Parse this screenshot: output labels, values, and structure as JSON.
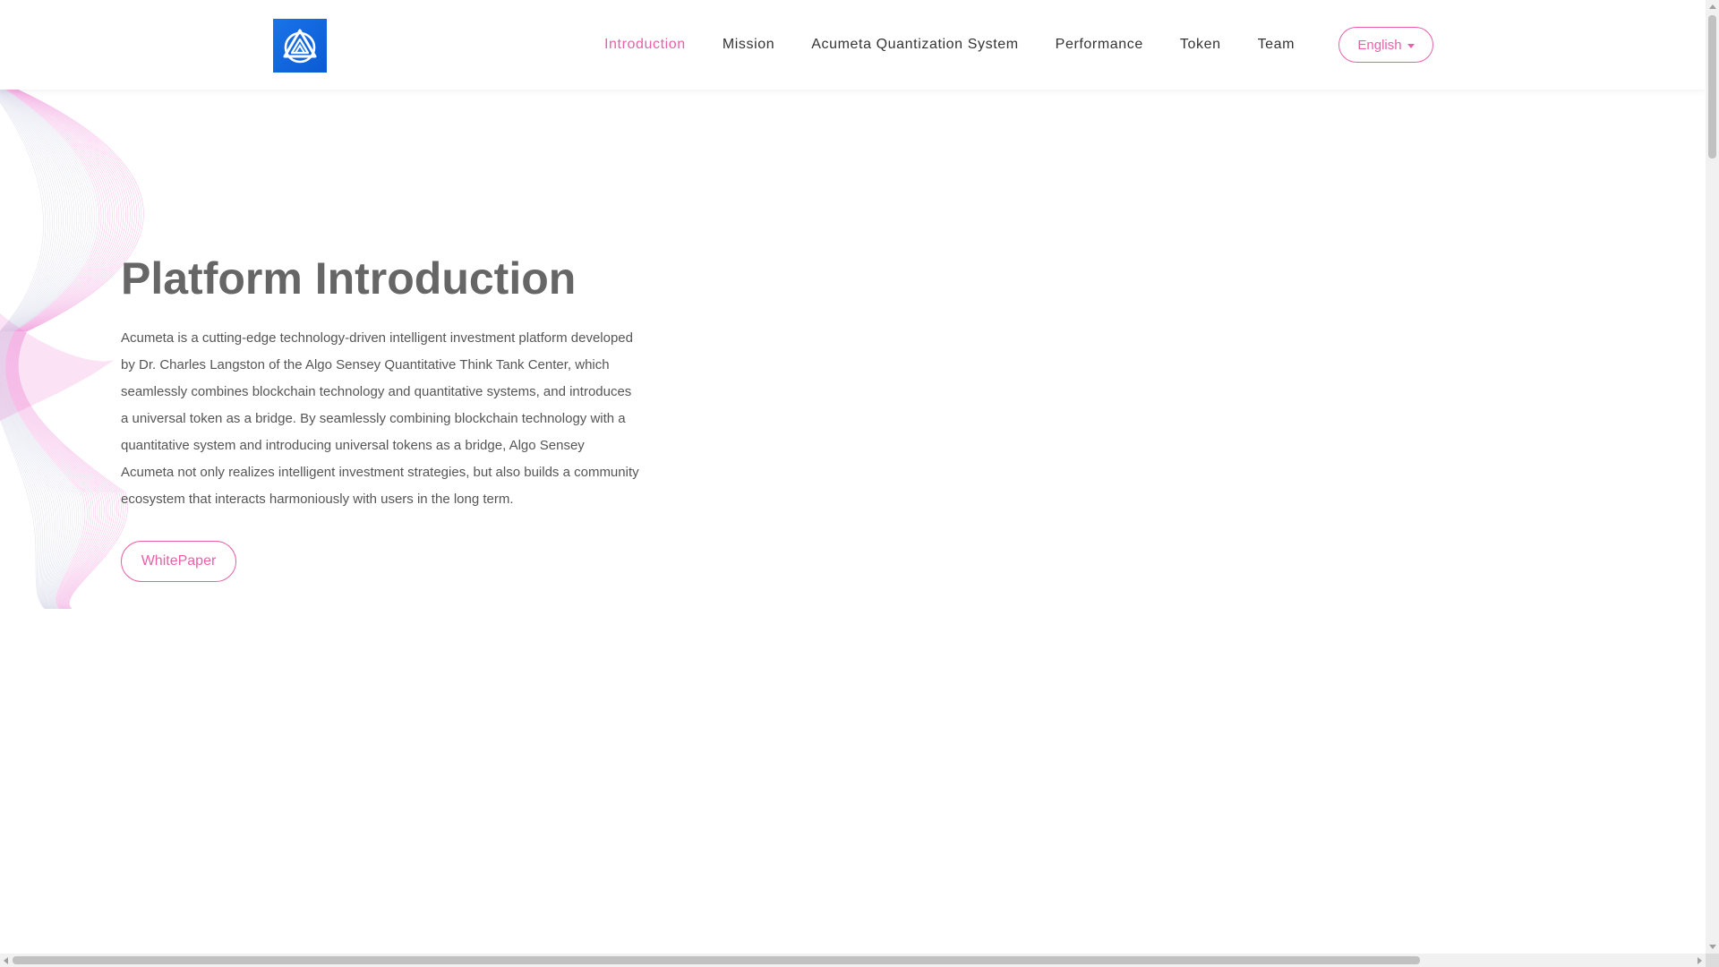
{
  "header": {
    "logo_icon": "acumeta-triangle-logo-icon",
    "nav": [
      {
        "label": "Introduction",
        "active": true
      },
      {
        "label": "Mission",
        "active": false
      },
      {
        "label": "Acumeta Quantization System",
        "active": false
      },
      {
        "label": "Performance",
        "active": false
      },
      {
        "label": "Token",
        "active": false
      },
      {
        "label": "Team",
        "active": false
      }
    ],
    "language": {
      "selected": "English",
      "icon": "caret-down-icon"
    }
  },
  "hero": {
    "title": "Platform Introduction",
    "body": "Acumeta is a cutting-edge technology-driven intelligent investment platform developed by Dr. Charles Langston of the Algo Sensey Quantitative Think Tank Center, which seamlessly combines blockchain technology and quantitative systems, and introduces a universal token as a bridge. By seamlessly combining blockchain technology with a quantitative system and introducing universal tokens as a bridge, Algo Sensey Acumeta not only realizes intelligent investment strategies, but also builds a community ecosystem that interacts harmoniously with users in the long term.",
    "button_label": "WhitePaper"
  },
  "colors": {
    "accent": "#e860a8",
    "logo_bg": "#1a73e8",
    "title": "#666666",
    "body_text": "#555555",
    "nav_text": "#333333"
  }
}
